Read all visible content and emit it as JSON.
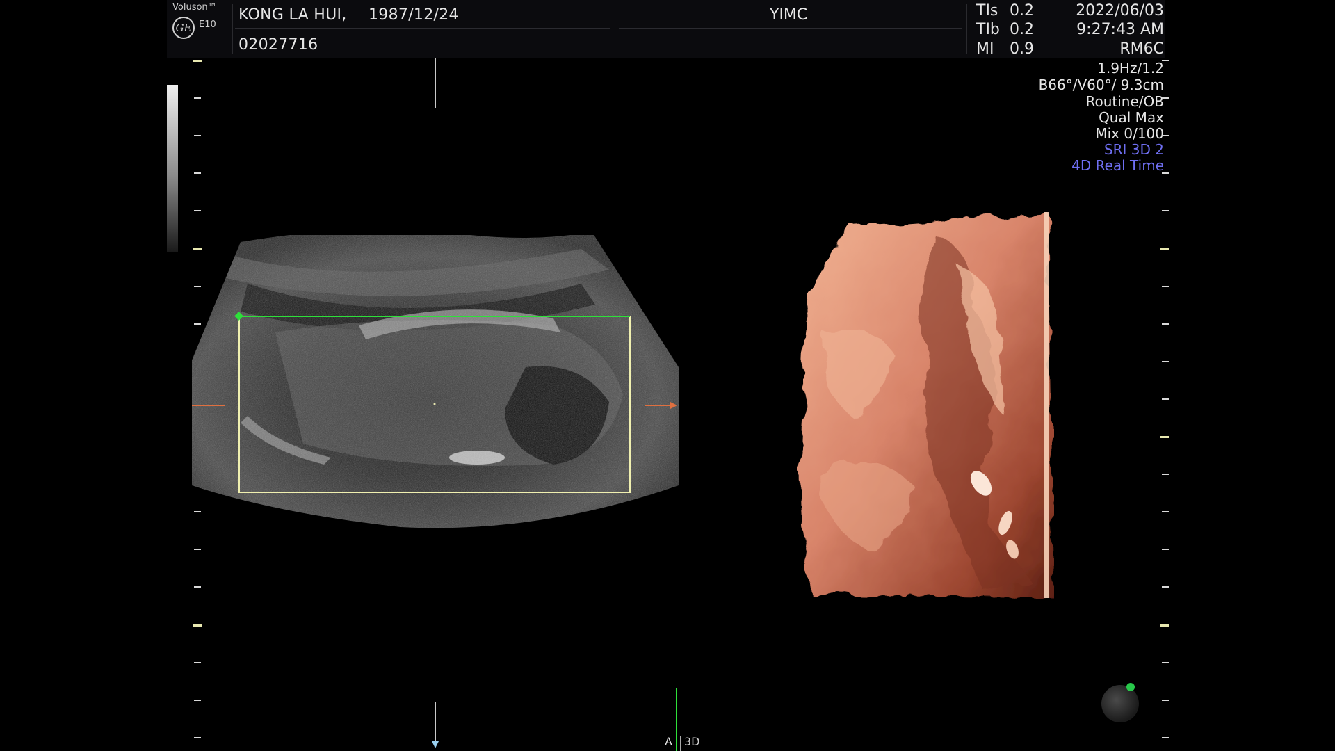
{
  "brand": {
    "name": "Voluson™",
    "model": "E10",
    "logo": "GE"
  },
  "patient": {
    "name": "KONG LA HUI,",
    "dob": "1987/12/24",
    "id": "02027716"
  },
  "institution": "YIMC",
  "indices": [
    {
      "label": "TIs",
      "value": "0.2"
    },
    {
      "label": "TIb",
      "value": "0.2"
    },
    {
      "label": "MI",
      "value": "0.9"
    }
  ],
  "datetime": {
    "date": "2022/06/03",
    "time": "9:27:43 AM"
  },
  "probe": "RM6C",
  "settings": [
    {
      "text": "1.9Hz/1.2",
      "highlight": false
    },
    {
      "text": "B66°/V60°/ 9.3cm",
      "highlight": false
    },
    {
      "text": "Routine/OB",
      "highlight": false
    },
    {
      "text": "Qual Max",
      "highlight": false
    },
    {
      "text": "Mix 0/100",
      "highlight": false
    },
    {
      "text": "SRI 3D 2",
      "highlight": true
    },
    {
      "text": "4D Real Time",
      "highlight": true
    }
  ],
  "bottom_labels": {
    "a": "A",
    "mode": "3D"
  },
  "colors": {
    "roi_box": "#f0f0b0",
    "roi_top": "#2ee03a",
    "cursor": "#e07040",
    "highlight": "#6f6ff2",
    "trackball_dot": "#27c84a"
  }
}
